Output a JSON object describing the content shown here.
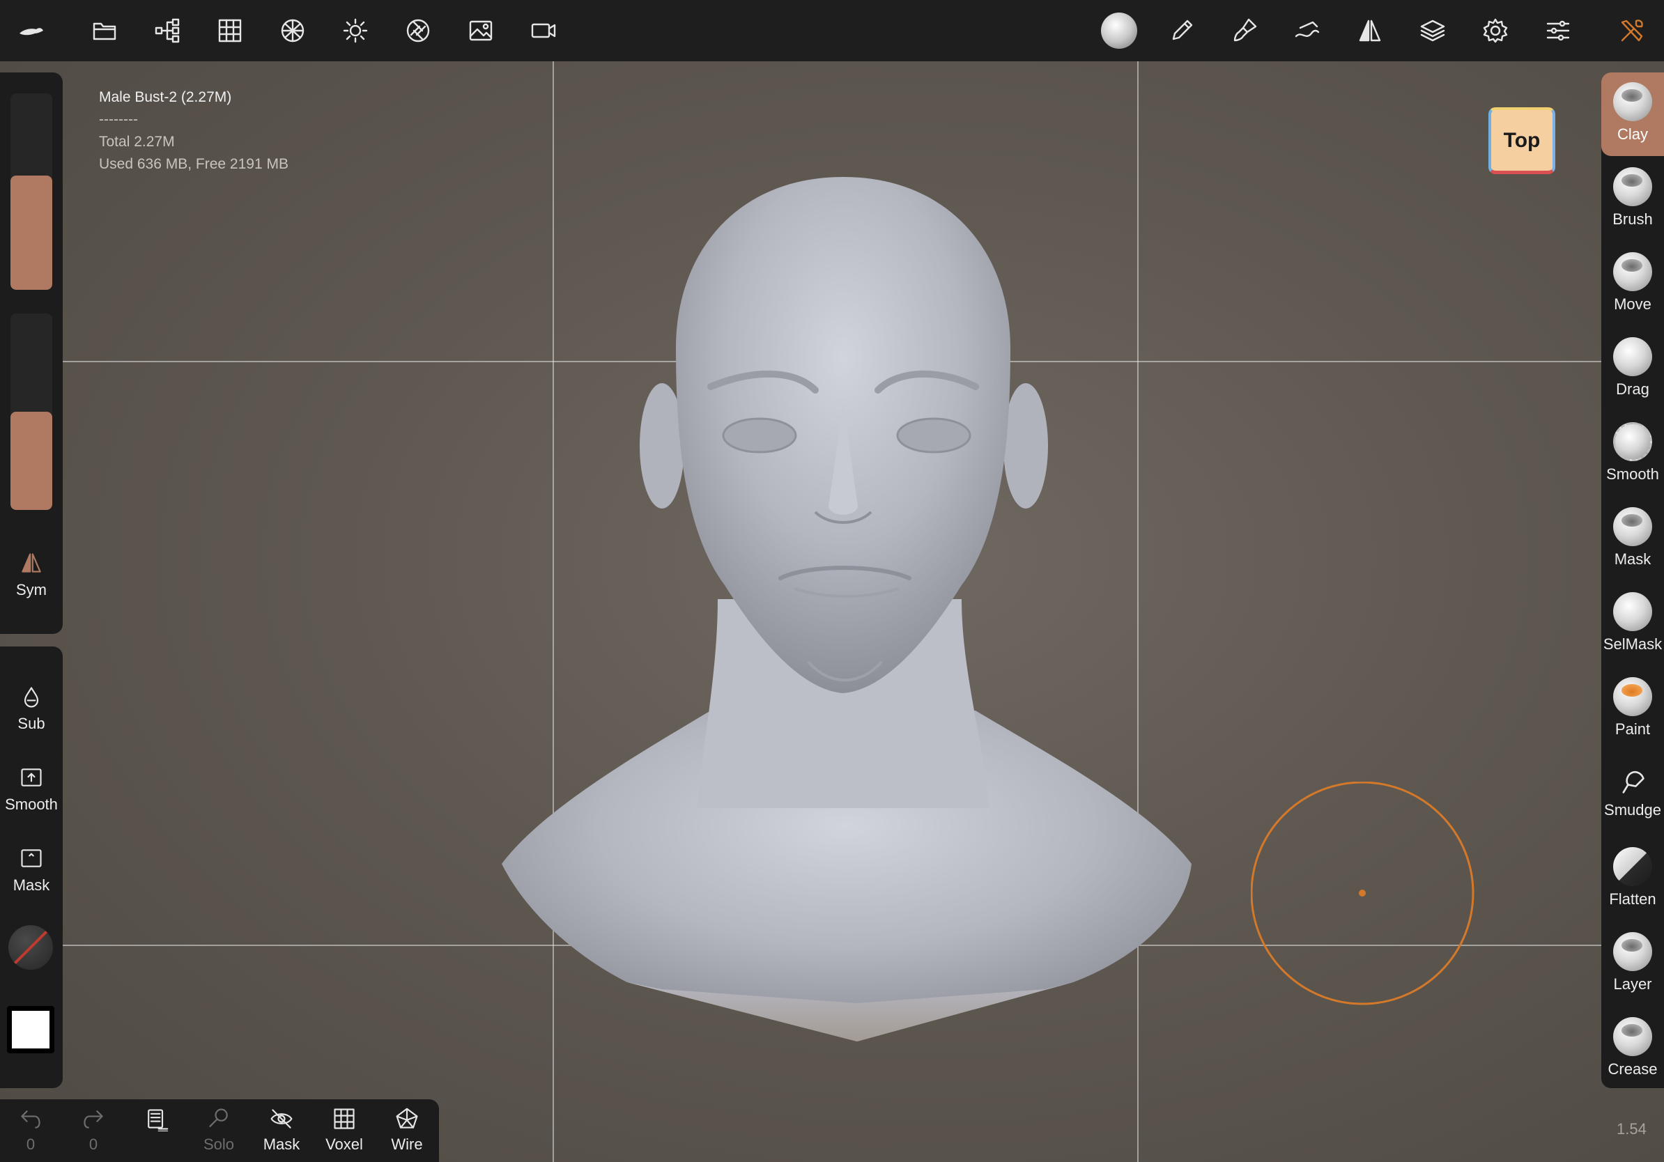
{
  "toolbar": {
    "left_icons": [
      "logo-icon",
      "folder-icon",
      "scene-tree-icon",
      "grid-icon",
      "topology-icon",
      "light-icon",
      "camera-aperture-icon",
      "background-image-icon",
      "video-camera-icon"
    ],
    "right_icons": [
      "material-sphere-icon",
      "pen-icon",
      "paint-brush-icon",
      "stroke-icon",
      "symmetry-icon",
      "layers-icon",
      "settings-icon",
      "sliders-icon",
      "tools-icon"
    ]
  },
  "info": {
    "mesh_name": "Male Bust-2 (2.27M)",
    "separator": "--------",
    "total": "Total 2.27M",
    "memory": "Used 636 MB,  Free 2191 MB"
  },
  "left_panel": {
    "radius_level": 0.58,
    "intensity_level": 0.5,
    "sym_label": "Sym",
    "sub_label": "Sub",
    "smooth_label": "Smooth",
    "mask_label": "Mask"
  },
  "tools": [
    {
      "label": "Clay",
      "active": true
    },
    {
      "label": "Brush",
      "active": false
    },
    {
      "label": "Move",
      "active": false
    },
    {
      "label": "Drag",
      "active": false
    },
    {
      "label": "Smooth",
      "active": false
    },
    {
      "label": "Mask",
      "active": false
    },
    {
      "label": "SelMask",
      "active": false
    },
    {
      "label": "Paint",
      "active": false
    },
    {
      "label": "Smudge",
      "active": false
    },
    {
      "label": "Flatten",
      "active": false
    },
    {
      "label": "Layer",
      "active": false
    },
    {
      "label": "Crease",
      "active": false
    }
  ],
  "bottom_bar": {
    "undo_count": "0",
    "redo_count": "0",
    "solo_label": "Solo",
    "mask_label": "Mask",
    "voxel_label": "Voxel",
    "wire_label": "Wire"
  },
  "view": {
    "cube_label": "Top",
    "zoom": "1.54"
  },
  "colors": {
    "accent": "#b07a62",
    "brush_cursor": "#d4792a",
    "toolbar_bg": "#1e1e1e"
  }
}
